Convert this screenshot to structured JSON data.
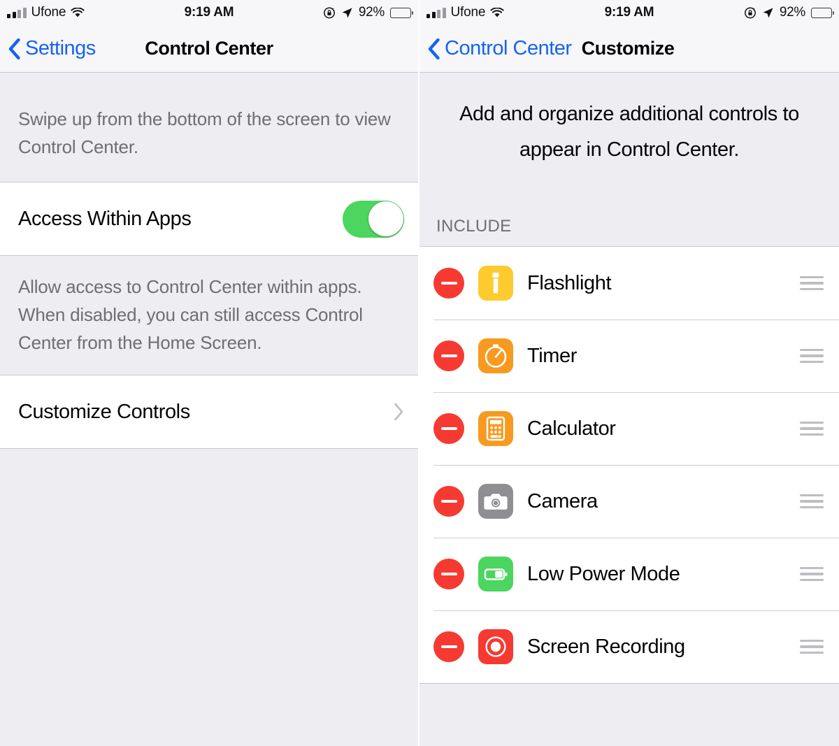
{
  "colors": {
    "accent_blue": "#1663F3",
    "toggle_green": "#4CD55F",
    "remove_red": "#F63A32",
    "page_background": "#EDEDF2",
    "cell_background": "#FFFFFF",
    "secondary_text": "#6E6E73"
  },
  "status_bar": {
    "carrier": "Ufone",
    "time": "9:19 AM",
    "battery_percent": "92%",
    "signal_bars_filled": 2,
    "signal_bars_total": 4,
    "wifi_icon": "wifi-icon",
    "rotation_lock_icon": "rotation-lock-icon",
    "location_icon": "location-arrow-icon",
    "battery_icon": "battery-icon"
  },
  "left_screen": {
    "nav": {
      "back_label": "Settings",
      "back_icon": "chevron-left-icon",
      "title": "Control Center"
    },
    "intro_note": "Swipe up from the bottom of the screen to view Control Center.",
    "access_row": {
      "label": "Access Within Apps",
      "toggle_state": "on"
    },
    "access_note": "Allow access to Control Center within apps. When disabled, you can still access Control Center from the Home Screen.",
    "customize_row": {
      "label": "Customize Controls",
      "disclosure_icon": "chevron-right-icon"
    }
  },
  "right_screen": {
    "nav": {
      "back_label": "Control Center",
      "back_icon": "chevron-left-icon",
      "title": "Customize"
    },
    "intro_text": "Add and organize additional controls to appear in Control Center.",
    "section_header": "INCLUDE",
    "include_items": [
      {
        "label": "Flashlight",
        "icon": "flashlight-icon",
        "icon_color": "#FECB2E",
        "remove_icon": "remove-minus-icon",
        "drag_icon": "reorder-handle-icon"
      },
      {
        "label": "Timer",
        "icon": "timer-icon",
        "icon_color": "#F79A1F",
        "remove_icon": "remove-minus-icon",
        "drag_icon": "reorder-handle-icon"
      },
      {
        "label": "Calculator",
        "icon": "calculator-icon",
        "icon_color": "#F79A1F",
        "remove_icon": "remove-minus-icon",
        "drag_icon": "reorder-handle-icon"
      },
      {
        "label": "Camera",
        "icon": "camera-icon",
        "icon_color": "#8E8E93",
        "remove_icon": "remove-minus-icon",
        "drag_icon": "reorder-handle-icon"
      },
      {
        "label": "Low Power Mode",
        "icon": "low-power-mode-icon",
        "icon_color": "#4CD55F",
        "remove_icon": "remove-minus-icon",
        "drag_icon": "reorder-handle-icon"
      },
      {
        "label": "Screen Recording",
        "icon": "screen-recording-icon",
        "icon_color": "#F63A32",
        "remove_icon": "remove-minus-icon",
        "drag_icon": "reorder-handle-icon"
      }
    ]
  }
}
